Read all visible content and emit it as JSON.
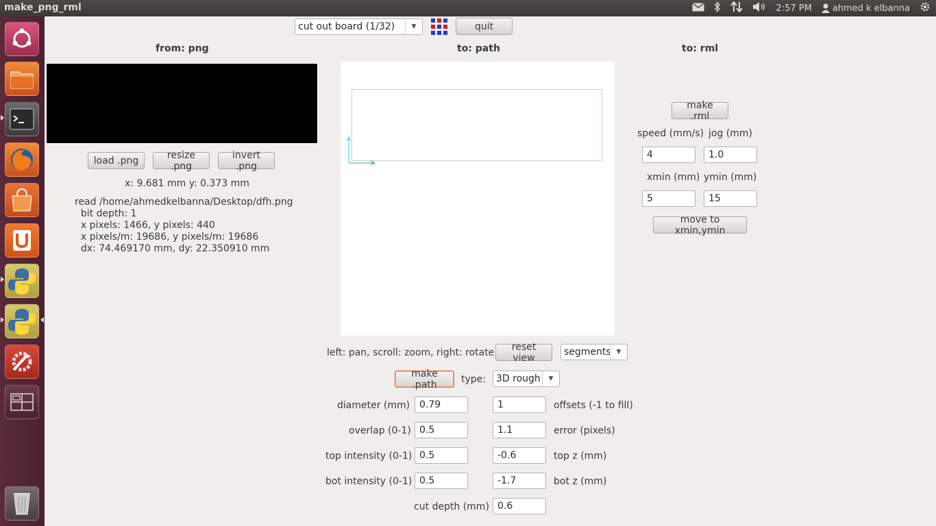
{
  "window": {
    "title": "make_png_rml"
  },
  "tray": {
    "time": "2:57 PM",
    "user": "ahmed k elbanna"
  },
  "launcher": {
    "items": [
      "ubuntu-dash",
      "files",
      "terminal",
      "firefox",
      "software-center",
      "ubuntu-one",
      "python",
      "python",
      "system-settings",
      "workspace-switcher",
      "trash"
    ]
  },
  "toolbar": {
    "mode_select": "cut out board (1/32)",
    "quit_label": "quit"
  },
  "from": {
    "header": "from: png",
    "load_label": "load .png",
    "resize_label": "resize .png",
    "invert_label": "invert .png",
    "coords": "x: 9.681 mm  y: 0.373 mm",
    "info_lines": [
      "read /home/ahmedkelbanna/Desktop/dfh.png",
      "  bit depth: 1",
      "  x pixels: 1466, y pixels: 440",
      "  x pixels/m: 19686, y pixels/m: 19686",
      "  dx: 74.469170 mm, dy: 22.350910 mm"
    ]
  },
  "to_path": {
    "header": "to: path",
    "view_hint": "left: pan, scroll: zoom, right: rotate",
    "reset_label": "reset view",
    "display_select": "segments",
    "make_path_label": "make .path",
    "type_label": "type:",
    "type_select": "3D rough",
    "params": {
      "diameter_label": "diameter (mm)",
      "diameter": "0.79",
      "offsets_label": "offsets (-1 to fill)",
      "offsets": "1",
      "overlap_label": "overlap (0-1)",
      "overlap": "0.5",
      "error_label": "error (pixels)",
      "error": "1.1",
      "top_intensity_label": "top intensity (0-1)",
      "top_intensity": "0.5",
      "top_z_label": "top z (mm)",
      "top_z": "-0.6",
      "bot_intensity_label": "bot intensity (0-1)",
      "bot_intensity": "0.5",
      "bot_z_label": "bot z (mm)",
      "bot_z": "-1.7",
      "cut_depth_label": "cut depth (mm)",
      "cut_depth": "0.6"
    }
  },
  "to_rml": {
    "header": "to: rml",
    "make_rml_label": "make .rml",
    "speed_label": "speed (mm/s)",
    "speed": "4",
    "jog_label": "jog (mm)",
    "jog": "1.0",
    "xmin_label": "xmin (mm)",
    "xmin": "5",
    "ymin_label": "ymin (mm)",
    "ymin": "15",
    "move_label": "move to xmin,ymin"
  },
  "colors": {
    "panel": "#3c3b37",
    "launcher": "#5a2a3a",
    "window_bg": "#efeeec",
    "focus": "#e06a3d"
  }
}
